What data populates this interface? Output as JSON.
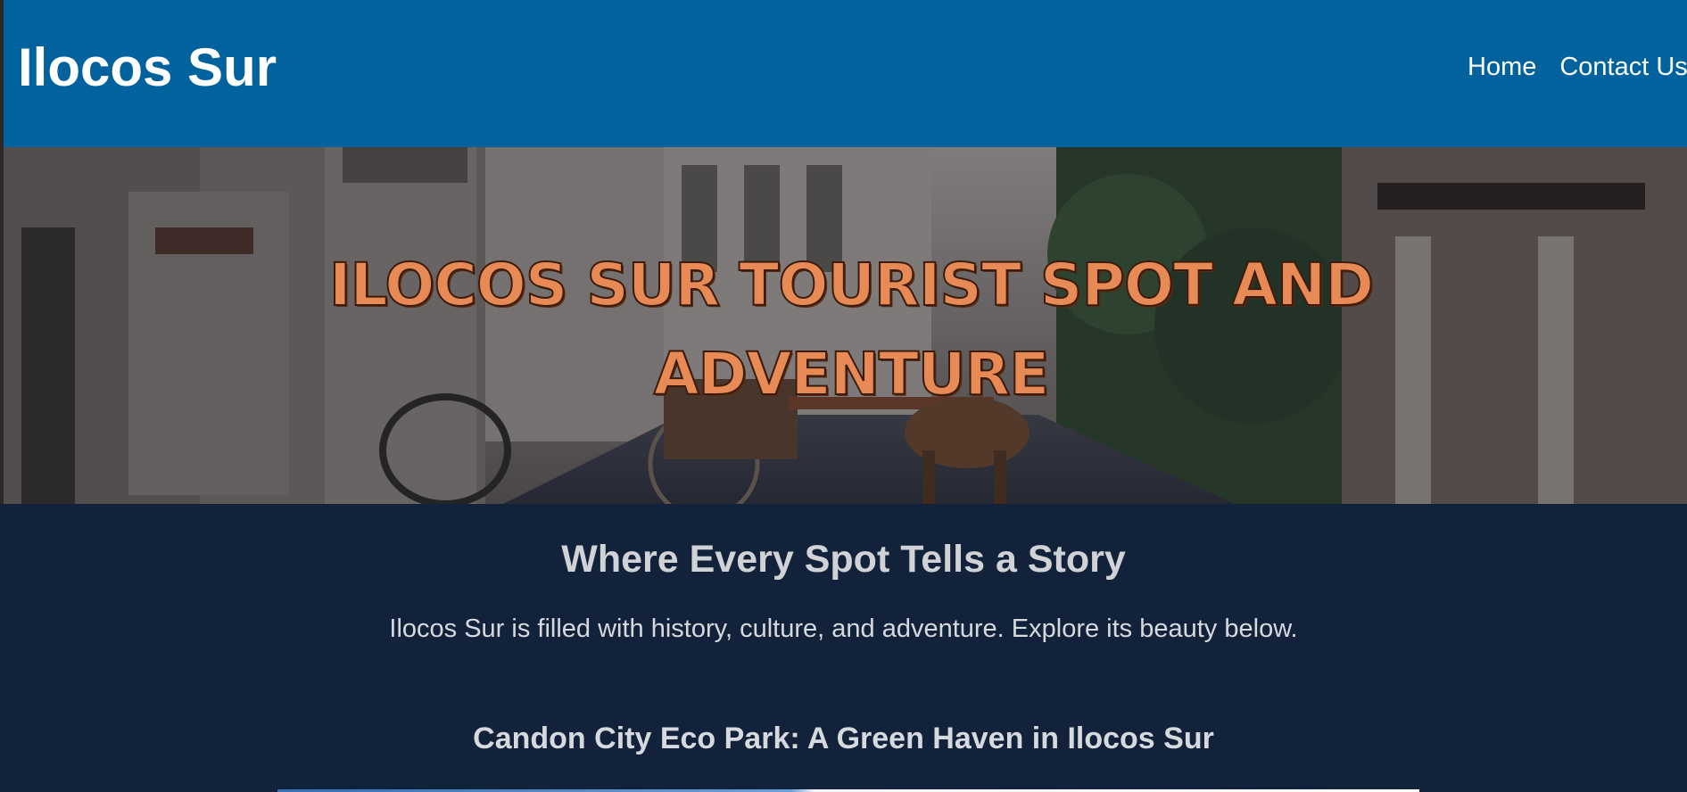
{
  "header": {
    "site_title": "Ilocos Sur",
    "nav": [
      {
        "label": "Home"
      },
      {
        "label": "Contact Us"
      }
    ]
  },
  "hero": {
    "title": "ILOCOS SUR TOURIST SPOT AND ADVENTURE"
  },
  "content": {
    "tagline": "Where Every Spot Tells a Story",
    "intro": "Ilocos Sur is filled with history, culture, and adventure. Explore its beauty below.",
    "spot_title": "Candon City Eco Park: A Green Haven in Ilocos Sur"
  },
  "colors": {
    "header_bg": "#01629e",
    "page_bg": "#11223a",
    "hero_title": "#e88a55",
    "text": "#d6d9de"
  }
}
